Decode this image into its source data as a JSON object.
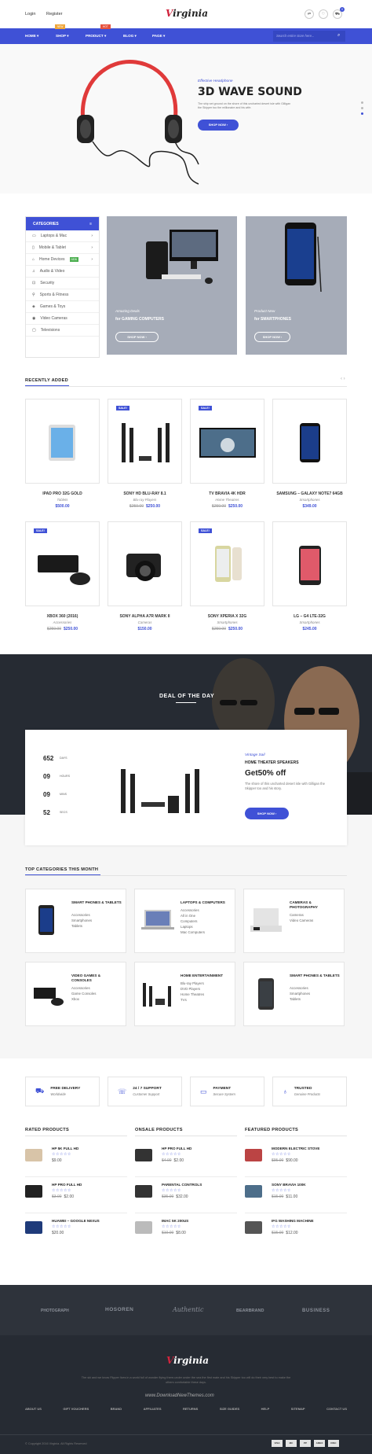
{
  "top": {
    "login": "Login",
    "register": "Register",
    "logo": "irginia",
    "logo_v": "V",
    "cart_count": "0"
  },
  "nav": {
    "items": [
      "HOME ▾",
      "SHOP ▾",
      "PRODUCT ▾",
      "BLOG ▾",
      "PAGE ▾"
    ],
    "badge_new": "NEW",
    "badge_hot": "HOT",
    "search_placeholder": "Search entire store here..."
  },
  "hero": {
    "kicker": "Effective Headphone",
    "title": "3D WAVE SOUND",
    "text": "The ship set ground on the shore of this uncharted desert isle with Gilligan the Skipper too the millionaire and his wife.",
    "button": "SHOP NOW ›"
  },
  "categories": {
    "header": "CATEGORIES",
    "items": [
      "Laptops & Mac",
      "Mobile & Tablet",
      "Home Devices",
      "Audio & Video",
      "Security",
      "Sports & Fitness",
      "Games & Toys",
      "Video Cameras",
      "Televisions"
    ],
    "badge": "NEW"
  },
  "banners": [
    {
      "kicker": "Amazing Deals",
      "line": "for GAMING COMPUTERS",
      "button": "SHOP NOW ›"
    },
    {
      "kicker": "Product New",
      "line": "for SMARTPHONES",
      "button": "SHOP NOW ›"
    }
  ],
  "recent": {
    "title": "RECENTLY ADDED",
    "products": [
      {
        "name": "IPAD PRO 32G GOLD",
        "cat": "Tablets",
        "old": "",
        "price": "$500.00",
        "sale": ""
      },
      {
        "name": "SONY HD BLU-RAY 8.1",
        "cat": "Blu-ray Players",
        "old": "$259.00",
        "price": "$250.00",
        "sale": "SALE!"
      },
      {
        "name": "TV BRAVIA 4K HDR",
        "cat": "Home Theatres",
        "old": "$259.00",
        "price": "$250.00",
        "sale": "SALE!"
      },
      {
        "name": "SAMSUNG – GALAXY NOTE7 64GB",
        "cat": "Smartphones",
        "old": "",
        "price": "$349.00",
        "sale": ""
      },
      {
        "name": "XBOX 360 (2016)",
        "cat": "Accessories",
        "old": "$259.00",
        "price": "$250.00",
        "sale": "SALE!"
      },
      {
        "name": "SONY ALPHA A7R MARK II",
        "cat": "Cameras",
        "old": "",
        "price": "$150.00",
        "sale": ""
      },
      {
        "name": "SONY XPERIA X 32G",
        "cat": "Smartphones",
        "old": "$259.00",
        "price": "$250.00",
        "sale": "SALE!"
      },
      {
        "name": "LG – G4 LTE-32G",
        "cat": "Smartphones",
        "old": "",
        "price": "$245.00",
        "sale": ""
      }
    ]
  },
  "deal": {
    "title": "DEAL OF THE DAY",
    "days": "652",
    "days_l": "DAYS",
    "hours": "09",
    "hours_l": "HOURS",
    "mins": "09",
    "mins_l": "MINS",
    "secs": "52",
    "secs_l": "SECS",
    "kicker": "Vintage Sail",
    "name": "HOME THEATER SPEAKERS",
    "offer": "Get50% off",
    "text": "The shore of this uncharted desert isle with Gilligan the Skipper too and his story.",
    "button": "SHOP NOW ›"
  },
  "topcats": {
    "title": "TOP CATEGORIES THIS MONTH",
    "items": [
      {
        "name": "SMART PHONES & TABLETS",
        "subs": [
          "Accessories",
          "Smartphones",
          "Tablets"
        ]
      },
      {
        "name": "LAPTOPS & COMPUTERS",
        "subs": [
          "Accessories",
          "All in One",
          "Computers",
          "Laptops",
          "Mac Computers"
        ]
      },
      {
        "name": "CAMERAS & PHOTOGRAPHY",
        "subs": [
          "Cameras",
          "Video Cameras"
        ]
      },
      {
        "name": "VIDEO GAMES & CONSOLES",
        "subs": [
          "Accessories",
          "Game Consoles",
          "Xbox"
        ]
      },
      {
        "name": "HOME ENTERTAINMENT",
        "subs": [
          "Blu-ray Players",
          "DVD Players",
          "Home Theatres",
          "TVs"
        ]
      },
      {
        "name": "SMART PHONES & TABLETS",
        "subs": [
          "Accessories",
          "Smartphones",
          "Tablets"
        ]
      }
    ]
  },
  "services": [
    {
      "t": "FREE DELIVERY",
      "s": "Worldwide"
    },
    {
      "t": "24 / 7 SUPPORT",
      "s": "Customer Support"
    },
    {
      "t": "PAYMENT",
      "s": "Secure System"
    },
    {
      "t": "TRUSTED",
      "s": "Genuine Products"
    }
  ],
  "lists": [
    {
      "title": "RATED PRODUCTS",
      "items": [
        {
          "n": "HP 5K FULL HD",
          "o": "",
          "p": "$9.00"
        },
        {
          "n": "HP PRO FULL HD",
          "o": "$3.00",
          "p": "$2.00"
        },
        {
          "n": "HUAWEI – GOOGLE NEXUS",
          "o": "",
          "p": "$20.00"
        }
      ]
    },
    {
      "title": "ONSALE PRODUCTS",
      "items": [
        {
          "n": "HP PRO FULL HD",
          "o": "$4.00",
          "p": "$2.00"
        },
        {
          "n": "PARENTAL CONTROLS",
          "o": "$35.00",
          "p": "$32.00"
        },
        {
          "n": "IMAC 5K 200US",
          "o": "$10.00",
          "p": "$8.00"
        }
      ]
    },
    {
      "title": "FEATURED PRODUCTS",
      "items": [
        {
          "n": "MODERN ELECTRIC STOVE",
          "o": "$95.00",
          "p": "$90.00"
        },
        {
          "n": "SONY BRAVIA 100K",
          "o": "$15.00",
          "p": "$11.00"
        },
        {
          "n": "IFG WASHING MACHINE",
          "o": "$15.00",
          "p": "$12.00"
        }
      ]
    }
  ],
  "brands": [
    "PHOTOGRAPH",
    "HOSOREN",
    "Authentic",
    "BEARBRAND",
    "BUSINESS"
  ],
  "footer": {
    "text": "The ski and we know Flipper lives in a world full of wonder flying there-under under the sea the first mate and his Skipper too will do their very best to make the others comfortable these days.",
    "watermark": "www.DownloadNewThemes.com",
    "links": [
      "ABOUT US",
      "GIFT VOUCHERS",
      "BRAND",
      "AFFILIATES",
      "RETURNS",
      "SIZE GUIDES",
      "HELP",
      "SITEMAP",
      "CONTACT US"
    ],
    "copyright": "© Copyright 2016 Virginia. All Rights Reserved",
    "pay": [
      "VISA",
      "MC",
      "PP",
      "AMEX",
      "DISC"
    ]
  },
  "colors": {
    "accent": "#3f51d6",
    "dark": "#262b33"
  }
}
